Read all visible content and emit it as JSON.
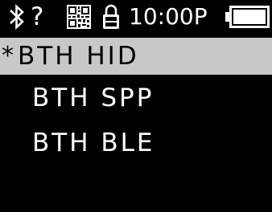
{
  "status_bar": {
    "bluetooth_icon": "bluetooth-icon",
    "unknown_glyph": "?",
    "qr_icon": "qr-code-icon",
    "lock_icon": "lock-icon",
    "time": "10:00P",
    "battery_icon": "battery-full-icon"
  },
  "menu": {
    "selected_marker": "*",
    "items": [
      {
        "label": "BTH HID",
        "selected": true
      },
      {
        "label": "BTH SPP",
        "selected": false
      },
      {
        "label": "BTH BLE",
        "selected": false
      }
    ]
  },
  "colors": {
    "background": "#000000",
    "text": "#ffffff",
    "selection_background": "#c8c8c8",
    "selection_text": "#000000"
  }
}
